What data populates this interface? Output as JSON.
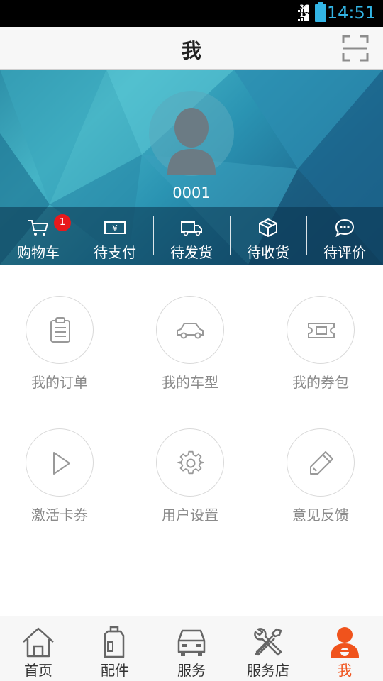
{
  "status_bar": {
    "network_top": "3G",
    "network_bottom": "1X",
    "time": "14:51"
  },
  "title_bar": {
    "title": "我",
    "scan_icon": "scan-frame-icon"
  },
  "profile": {
    "username": "0001",
    "avatar_icon": "default-avatar-icon"
  },
  "orders": [
    {
      "label": "购物车",
      "icon": "cart-icon",
      "badge": "1"
    },
    {
      "label": "待支付",
      "icon": "yen-bill-icon"
    },
    {
      "label": "待发货",
      "icon": "truck-icon"
    },
    {
      "label": "待收货",
      "icon": "box-icon"
    },
    {
      "label": "待评价",
      "icon": "chat-bubble-icon"
    }
  ],
  "grid": [
    {
      "label": "我的订单",
      "icon": "clipboard-icon"
    },
    {
      "label": "我的车型",
      "icon": "car-icon"
    },
    {
      "label": "我的券包",
      "icon": "ticket-icon"
    },
    {
      "label": "激活卡券",
      "icon": "play-icon"
    },
    {
      "label": "用户设置",
      "icon": "gear-icon"
    },
    {
      "label": "意见反馈",
      "icon": "pencil-icon"
    }
  ],
  "tabs": [
    {
      "label": "首页",
      "icon": "home-icon"
    },
    {
      "label": "配件",
      "icon": "oil-bottle-icon"
    },
    {
      "label": "服务",
      "icon": "car-front-icon"
    },
    {
      "label": "服务店",
      "icon": "tools-icon"
    },
    {
      "label": "我",
      "icon": "user-icon",
      "active": true
    }
  ],
  "colors": {
    "accent": "#f0531c",
    "badge": "#e8191c",
    "status_clock": "#33b5e5"
  }
}
